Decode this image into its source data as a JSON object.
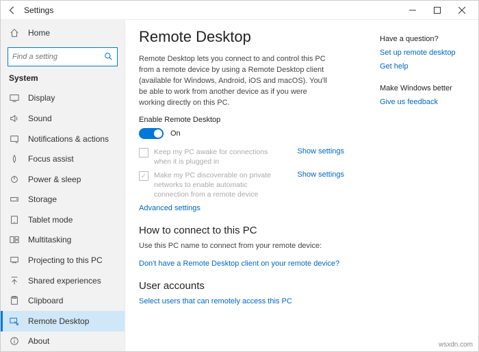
{
  "window": {
    "title": "Settings"
  },
  "sidebar": {
    "home": "Home",
    "search_placeholder": "Find a setting",
    "category": "System",
    "items": [
      {
        "label": "Display"
      },
      {
        "label": "Sound"
      },
      {
        "label": "Notifications & actions"
      },
      {
        "label": "Focus assist"
      },
      {
        "label": "Power & sleep"
      },
      {
        "label": "Storage"
      },
      {
        "label": "Tablet mode"
      },
      {
        "label": "Multitasking"
      },
      {
        "label": "Projecting to this PC"
      },
      {
        "label": "Shared experiences"
      },
      {
        "label": "Clipboard"
      },
      {
        "label": "Remote Desktop"
      },
      {
        "label": "About"
      }
    ]
  },
  "page": {
    "title": "Remote Desktop",
    "description": "Remote Desktop lets you connect to and control this PC from a remote device by using a Remote Desktop client (available for Windows, Android, iOS and macOS). You'll be able to work from another device as if you were working directly on this PC.",
    "enable_label": "Enable Remote Desktop",
    "toggle_state": "On",
    "opt1": "Keep my PC awake for connections when it is plugged in",
    "opt1_link": "Show settings",
    "opt2": "Make my PC discoverable on private networks to enable automatic connection from a remote device",
    "opt2_link": "Show settings",
    "advanced": "Advanced settings",
    "connect_heading": "How to connect to this PC",
    "connect_text": "Use this PC name to connect from your remote device:",
    "no_client_link": "Don't have a Remote Desktop client on your remote device?",
    "accounts_heading": "User accounts",
    "select_users": "Select users that can remotely access this PC"
  },
  "aside": {
    "q_heading": "Have a question?",
    "setup": "Set up remote desktop",
    "help": "Get help",
    "better_heading": "Make Windows better",
    "feedback": "Give us feedback"
  },
  "watermark": "wsxdn.com"
}
